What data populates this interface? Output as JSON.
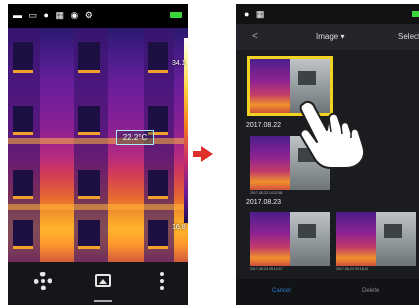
{
  "camera_screen": {
    "temp_high": "34.1",
    "temp_low": "16.8",
    "spot_label": "22.2°C",
    "bottom_icons": [
      "settings-icon",
      "gallery-icon",
      "more-icon"
    ]
  },
  "gallery_screen": {
    "nav": {
      "back": "<",
      "title": "Image ▾",
      "select": "Select"
    },
    "dates": [
      "2017.08.22",
      "2017.08.23"
    ],
    "captions": [
      "2017-08-22 14:22:55",
      "2017-08-22 14:35:04",
      "2017-08-23 09:12:47",
      "2017-08-23 09:18:31"
    ],
    "bottom": {
      "cancel": "Cancel",
      "delete": "Delete"
    }
  },
  "colors": {
    "arrow": "#e0302a",
    "selection": "#f1d21e",
    "battery": "#3bd43b"
  }
}
